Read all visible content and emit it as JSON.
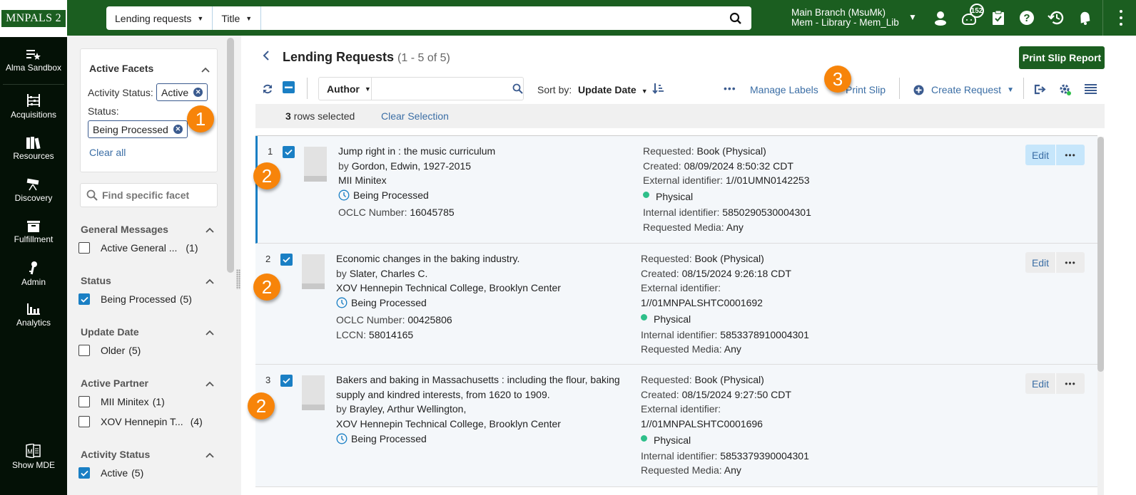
{
  "topbar": {
    "logo": "MNPALS 2",
    "search_scope": "Lending requests",
    "search_field": "Title",
    "search_value": "",
    "branch_line1": "Main Branch (MsuMk)",
    "branch_line2": "Mem - Library - Mem_Lib",
    "notifications_count": "152",
    "icons": [
      "user-icon",
      "chat-bot-icon",
      "tasks-clipboard-icon",
      "help-icon",
      "history-icon",
      "bell-icon",
      "more-vertical-icon"
    ]
  },
  "leftnav": {
    "items": [
      {
        "label": "Alma Sandbox",
        "icon": "sandbox-star-icon"
      },
      {
        "label": "Acquisitions",
        "icon": "abacus-icon"
      },
      {
        "label": "Resources",
        "icon": "books-icon"
      },
      {
        "label": "Discovery",
        "icon": "telescope-icon"
      },
      {
        "label": "Fulfillment",
        "icon": "box-icon"
      },
      {
        "label": "Admin",
        "icon": "key-icon"
      },
      {
        "label": "Analytics",
        "icon": "bar-chart-icon"
      },
      {
        "label": "Show MDE",
        "icon": "mde-icon"
      }
    ]
  },
  "facets": {
    "active_title": "Active Facets",
    "active": [
      {
        "label": "Activity Status:",
        "value": "Active"
      },
      {
        "label": "Status:",
        "value": "Being Processed"
      }
    ],
    "clear_all": "Clear all",
    "search_placeholder": "Find specific facet",
    "groups": [
      {
        "title": "General Messages",
        "options": [
          {
            "label": "Active General ...",
            "count": "(1)",
            "checked": false
          }
        ]
      },
      {
        "title": "Status",
        "options": [
          {
            "label": "Being Processed",
            "count": "(5)",
            "checked": true
          }
        ]
      },
      {
        "title": "Update Date",
        "options": [
          {
            "label": "Older",
            "count": "(5)",
            "checked": false
          }
        ]
      },
      {
        "title": "Active Partner",
        "options": [
          {
            "label": "MII Minitex",
            "count": "(1)",
            "checked": false
          },
          {
            "label": "XOV Hennepin T...",
            "count": "(4)",
            "checked": false
          }
        ]
      },
      {
        "title": "Activity Status",
        "options": [
          {
            "label": "Active",
            "count": "(5)",
            "checked": true
          }
        ]
      }
    ]
  },
  "main": {
    "title": "Lending Requests",
    "count": "(1 - 5 of 5)",
    "print_slip_report": "Print Slip Report",
    "search_field": "Author",
    "search_value": "",
    "sort_label": "Sort by:",
    "sort_value": "Update Date",
    "manage_labels": "Manage Labels",
    "print_slip": "Print Slip",
    "create_request": "Create Request",
    "selected_count": "3",
    "selected_text": "rows selected",
    "clear_selection": "Clear Selection",
    "edit_label": "Edit",
    "rows": [
      {
        "num": "1",
        "title": "Jump right in : the music curriculum",
        "by": "by",
        "author": "Gordon, Edwin, 1927-2015",
        "partner": "MII Minitex",
        "status": "Being Processed",
        "oclc_label": "OCLC Number:",
        "oclc": "16045785",
        "lccn_label": "",
        "lccn": "",
        "requested_label": "Requested:",
        "requested": "Book (Physical)",
        "created_label": "Created:",
        "created": "08/09/2024 8:50:32 CDT",
        "ext_label": "External identifier:",
        "ext": "1//01UMN0142253",
        "format": "Physical",
        "int_label": "Internal identifier:",
        "int": "5850290530004301",
        "media_label": "Requested Media:",
        "media": "Any",
        "selected": true
      },
      {
        "num": "2",
        "title": "Economic changes in the baking industry.",
        "by": "by",
        "author": "Slater, Charles C.",
        "partner": "XOV Hennepin Technical College, Brooklyn Center",
        "status": "Being Processed",
        "oclc_label": "OCLC Number:",
        "oclc": "00425806",
        "lccn_label": "LCCN:",
        "lccn": "58014165",
        "requested_label": "Requested:",
        "requested": "Book (Physical)",
        "created_label": "Created:",
        "created": "08/15/2024 9:26:18 CDT",
        "ext_label": "External identifier:",
        "ext": "1//01MNPALSHTC0001692",
        "format": "Physical",
        "int_label": "Internal identifier:",
        "int": "5853378910004301",
        "media_label": "Requested Media:",
        "media": "Any",
        "selected": true
      },
      {
        "num": "3",
        "title": "Bakers and baking in Massachusetts : including the flour, baking supply and kindred interests, from 1620 to 1909.",
        "by": "by",
        "author": "Brayley, Arthur Wellington,",
        "partner": "XOV Hennepin Technical College, Brooklyn Center",
        "status": "Being Processed",
        "oclc_label": "",
        "oclc": "",
        "lccn_label": "",
        "lccn": "",
        "requested_label": "Requested:",
        "requested": "Book (Physical)",
        "created_label": "Created:",
        "created": "08/15/2024 9:27:50 CDT",
        "ext_label": "External identifier:",
        "ext": "1//01MNPALSHTC0001696",
        "format": "Physical",
        "int_label": "Internal identifier:",
        "int": "5853379390004301",
        "media_label": "Requested Media:",
        "media": "Any",
        "selected": true
      }
    ]
  },
  "callouts": [
    "1",
    "2",
    "2",
    "2",
    "3"
  ],
  "colors": {
    "brand_green": "#1b5e20",
    "nav_dark": "#041106",
    "accent_blue": "#1a7fc4",
    "link_blue": "#3b6ea5",
    "callout_orange": "#f7840a",
    "physical_dot": "#2ebf8a"
  }
}
